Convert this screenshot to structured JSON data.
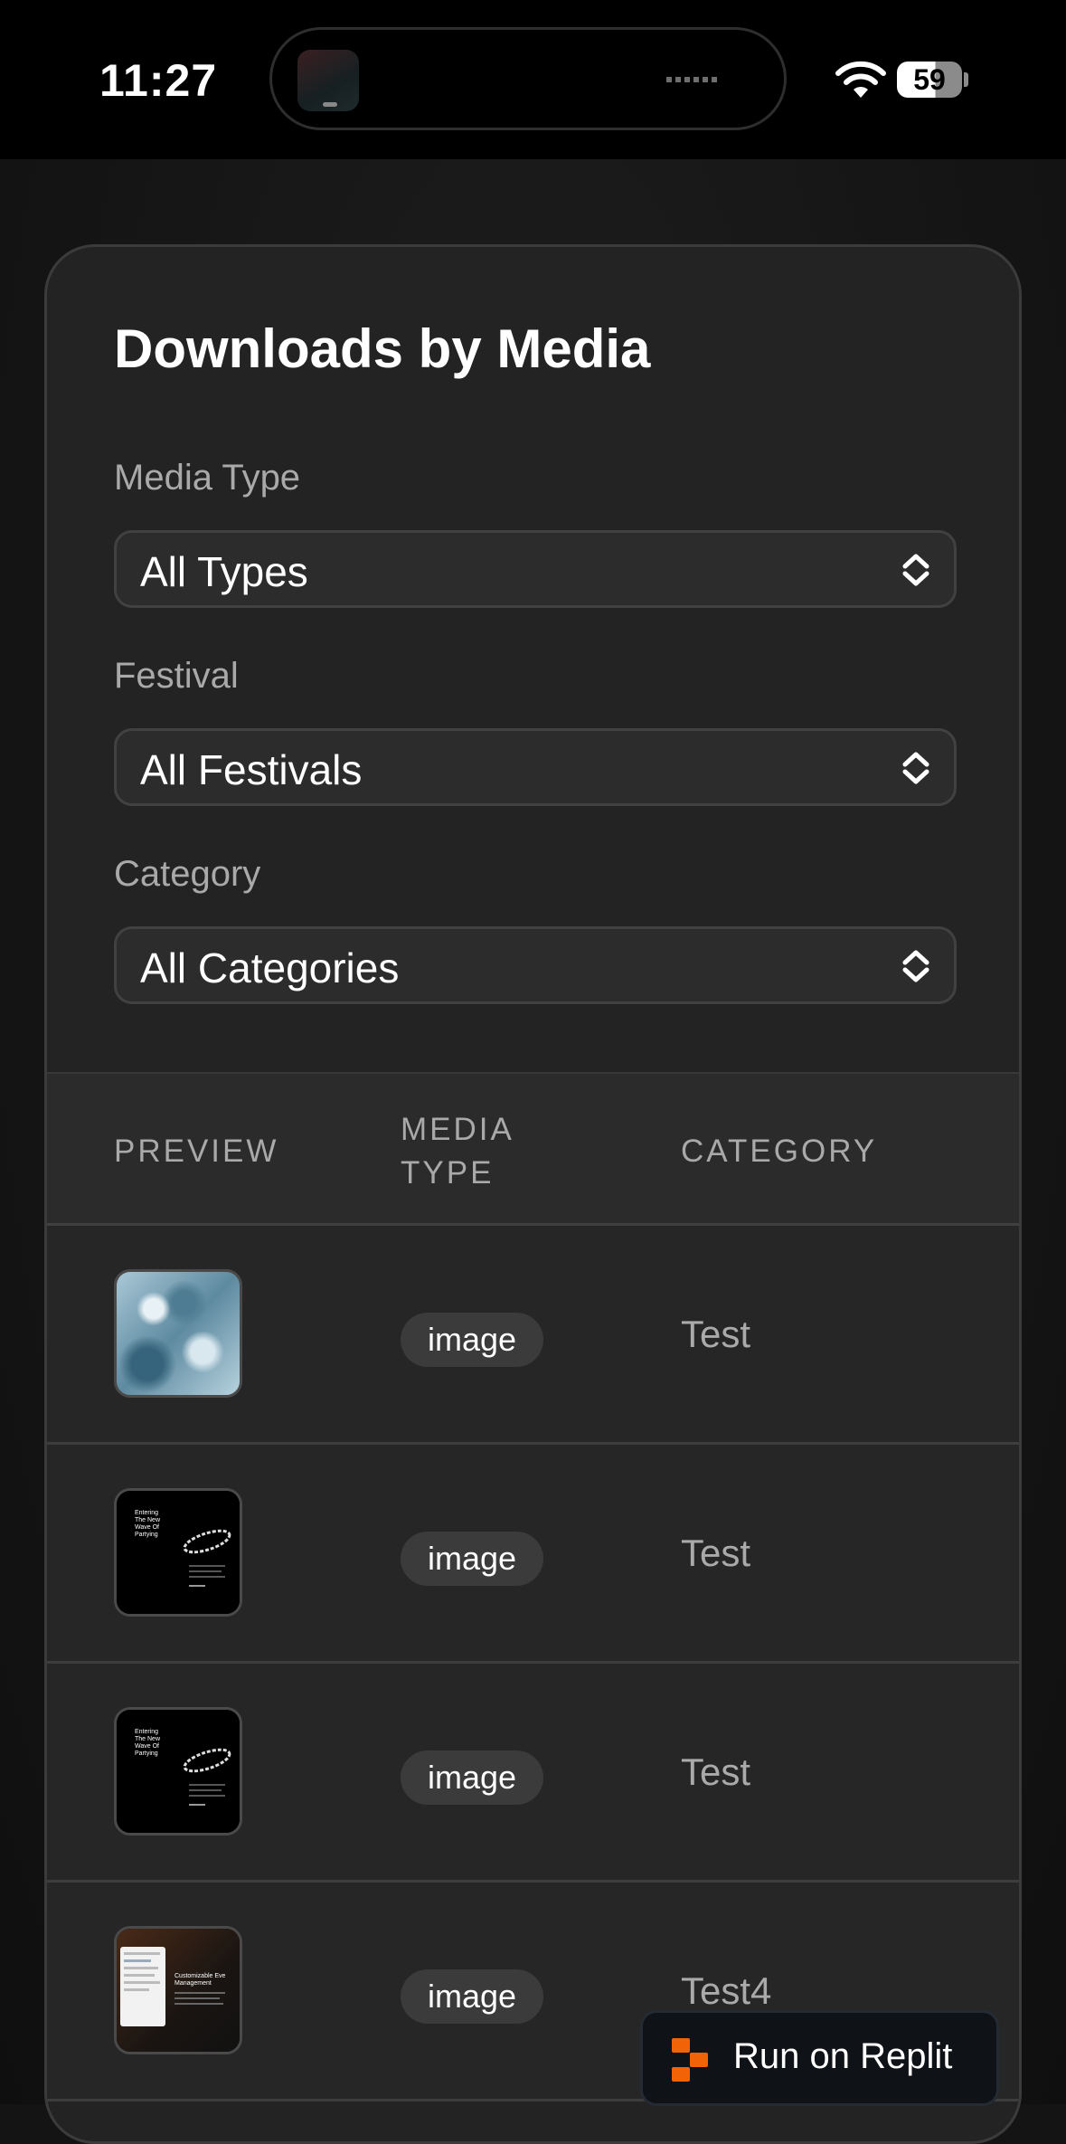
{
  "status_bar": {
    "time": "11:27",
    "battery": "59"
  },
  "page": {
    "title": "Downloads by Media",
    "filters": [
      {
        "label": "Media Type",
        "value": "All Types"
      },
      {
        "label": "Festival",
        "value": "All Festivals"
      },
      {
        "label": "Category",
        "value": "All Categories"
      }
    ],
    "table": {
      "headers": {
        "preview": "PREVIEW",
        "media_type_line1": "MEDIA",
        "media_type_line2": "TYPE",
        "category": "CATEGORY"
      },
      "rows": [
        {
          "media_type": "image",
          "category": "Test"
        },
        {
          "media_type": "image",
          "category": "Test"
        },
        {
          "media_type": "image",
          "category": "Test"
        },
        {
          "media_type": "image",
          "category": "Test4"
        }
      ]
    }
  },
  "thumb_text": {
    "poster_line1": "Entering",
    "poster_line2": "The New",
    "poster_line3": "Wave Of",
    "poster_line4": "Partying",
    "app_title_line1": "Customizable Eve",
    "app_title_line2": "Management"
  },
  "replit_button": {
    "label": "Run on Replit",
    "icon": "replit-logo-icon",
    "accent": "#f26207"
  },
  "colors": {
    "card_bg": "#232323",
    "table_header_bg": "#2b2b2b",
    "pill_bg": "#3b3b3b"
  }
}
